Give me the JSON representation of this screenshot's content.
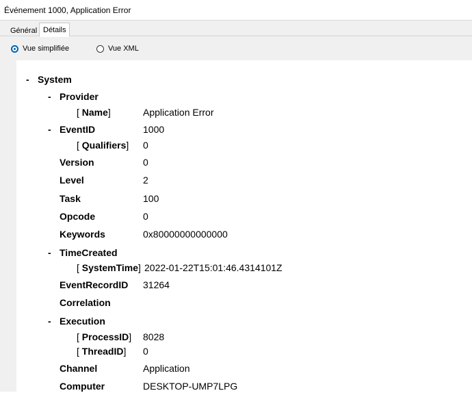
{
  "window": {
    "title": "Événement 1000, Application Error"
  },
  "tabs": [
    {
      "label": "Général",
      "active": false
    },
    {
      "label": "Détails",
      "active": true
    }
  ],
  "view_options": [
    {
      "label": "Vue simplifiée",
      "selected": true
    },
    {
      "label": "Vue XML",
      "selected": false
    }
  ],
  "event": {
    "system": {
      "label": "System",
      "toggle": "-"
    },
    "provider": {
      "label": "Provider",
      "toggle": "-"
    },
    "name": {
      "label": "Name",
      "value": "Application Error"
    },
    "event_id": {
      "label": "EventID",
      "toggle": "-",
      "value": "1000"
    },
    "qualifiers": {
      "label": "Qualifiers",
      "value": "0"
    },
    "version": {
      "label": "Version",
      "value": "0"
    },
    "level": {
      "label": "Level",
      "value": "2"
    },
    "task": {
      "label": "Task",
      "value": "100"
    },
    "opcode": {
      "label": "Opcode",
      "value": "0"
    },
    "keywords": {
      "label": "Keywords",
      "value": "0x80000000000000"
    },
    "time_created": {
      "label": "TimeCreated",
      "toggle": "-"
    },
    "system_time": {
      "label": "SystemTime",
      "value": "2022-01-22T15:01:46.4314101Z"
    },
    "event_record_id": {
      "label": "EventRecordID",
      "value": "31264"
    },
    "correlation": {
      "label": "Correlation"
    },
    "execution": {
      "label": "Execution",
      "toggle": "-"
    },
    "process_id": {
      "label": "ProcessID",
      "value": "8028"
    },
    "thread_id": {
      "label": "ThreadID",
      "value": "0"
    },
    "channel": {
      "label": "Channel",
      "value": "Application"
    },
    "computer": {
      "label": "Computer",
      "value": "DESKTOP-UMP7LPG"
    }
  },
  "colors": {
    "accent": "#0063b1",
    "panel_bg": "#f0f0f0",
    "content_bg": "#ffffff"
  }
}
